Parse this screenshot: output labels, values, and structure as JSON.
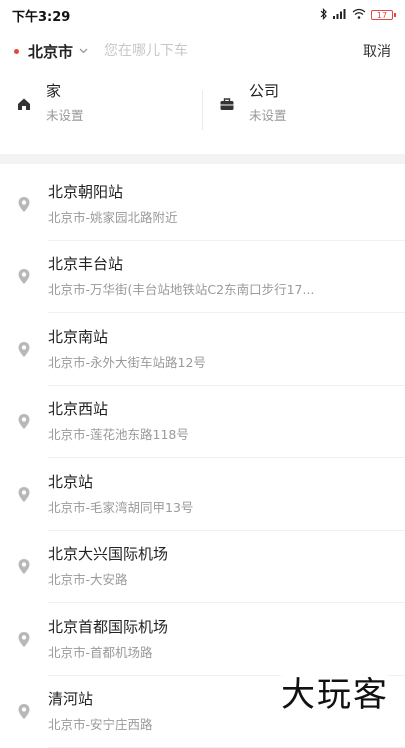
{
  "status_bar": {
    "time": "下午3:29",
    "battery": "17"
  },
  "search": {
    "city": "北京市",
    "placeholder": "您在哪儿下车",
    "cancel_label": "取消"
  },
  "shortcuts": {
    "home": {
      "title": "家",
      "subtitle": "未设置",
      "icon": "home-icon"
    },
    "company": {
      "title": "公司",
      "subtitle": "未设置",
      "icon": "briefcase-icon"
    }
  },
  "results": [
    {
      "title": "北京朝阳站",
      "address": "北京市-姚家园北路附近"
    },
    {
      "title": "北京丰台站",
      "address": "北京市-万华街(丰台站地铁站C2东南口步行17..."
    },
    {
      "title": "北京南站",
      "address": "北京市-永外大街车站路12号"
    },
    {
      "title": "北京西站",
      "address": "北京市-莲花池东路118号"
    },
    {
      "title": "北京站",
      "address": "北京市-毛家湾胡同甲13号"
    },
    {
      "title": "北京大兴国际机场",
      "address": "北京市-大安路"
    },
    {
      "title": "北京首都国际机场",
      "address": "北京市-首都机场路"
    },
    {
      "title": "清河站",
      "address": "北京市-安宁庄西路"
    }
  ],
  "watermark": "大玩客",
  "colors": {
    "accent_red": "#e8453c",
    "muted_text": "#999999",
    "band": "#f3f3f3"
  }
}
